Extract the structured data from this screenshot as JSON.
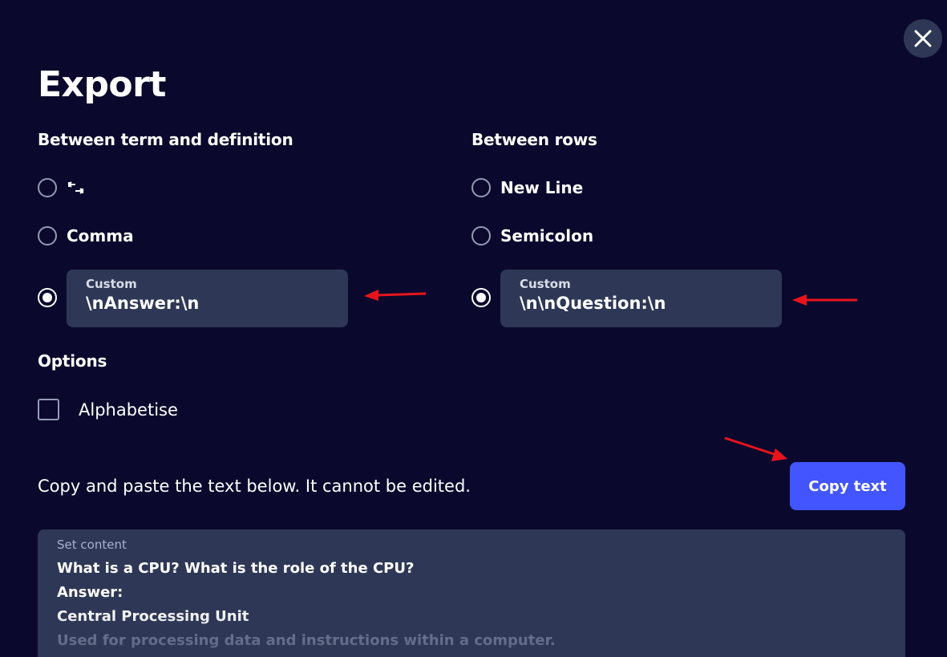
{
  "dialog": {
    "title": "Export",
    "close_icon": "close-icon"
  },
  "term_definition": {
    "heading": "Between term and definition",
    "options": [
      {
        "label": "",
        "icon": "tab-icon",
        "selected": false
      },
      {
        "label": "Comma",
        "selected": false
      },
      {
        "label": "Custom",
        "selected": true
      }
    ],
    "custom_caption": "Custom",
    "custom_value": "\\nAnswer:\\n"
  },
  "rows": {
    "heading": "Between rows",
    "options": [
      {
        "label": "New Line",
        "selected": false
      },
      {
        "label": "Semicolon",
        "selected": false
      },
      {
        "label": "Custom",
        "selected": true
      }
    ],
    "custom_caption": "Custom",
    "custom_value": "\\n\\nQuestion:\\n"
  },
  "options": {
    "heading": "Options",
    "alphabetise_label": "Alphabetise",
    "alphabetise_checked": false
  },
  "export": {
    "instructions": "Copy and paste the text below. It cannot be edited.",
    "copy_button": "Copy text",
    "content_caption": "Set content",
    "content_lines": [
      "What is a CPU? What is the role of the CPU?",
      "Answer:",
      "Central Processing Unit",
      "Used for processing data and instructions within a computer."
    ]
  },
  "colors": {
    "background": "#0a092d",
    "panel": "#2e3856",
    "accent": "#4255ff",
    "annotation_arrow": "#e8141c"
  }
}
